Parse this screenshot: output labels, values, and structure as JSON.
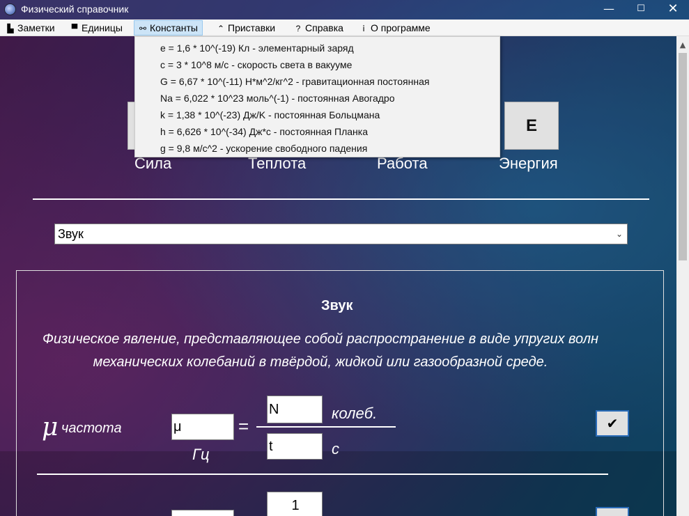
{
  "window": {
    "title": "Физический справочник",
    "minimize": "—",
    "maximize": "☐",
    "close": "✕"
  },
  "menu": [
    {
      "label": "Заметки",
      "icon": "▙",
      "icon_name": "notes-icon"
    },
    {
      "label": "Единицы",
      "icon": "▀",
      "icon_name": "units-icon"
    },
    {
      "label": "Константы",
      "icon": "⚯",
      "icon_name": "constants-icon"
    },
    {
      "label": "Приставки",
      "icon": "⌃",
      "icon_name": "prefixes-icon"
    },
    {
      "label": "Справка",
      "icon": "?",
      "icon_name": "help-icon"
    },
    {
      "label": "О программе",
      "icon": "ⅰ",
      "icon_name": "about-icon"
    }
  ],
  "constants": [
    "e = 1,6 * 10^(-19) Кл - элементарный заряд",
    "c = 3 * 10^8 м/с - скорость света в вакууме",
    "G = 6,67 * 10^(-11) Н*м^2/кг^2 - гравитационная постоянная",
    "Na = 6,022 * 10^23 моль^(-1) - постоянная Авогадро",
    "k = 1,38 * 10^(-23) Дж/K - постоянная Больцмана",
    "h = 6,626 * 10^(-34) Дж*с - постоянная Планка",
    "g = 9,8 м/с^2 - ускорение свободного падения"
  ],
  "tiles": {
    "energy_button": "E"
  },
  "categories": {
    "force": "Сила",
    "heat": "Теплота",
    "work": "Работа",
    "energy": "Энергия"
  },
  "combo": {
    "selected": "Звук",
    "arrow": "⌄"
  },
  "topic": {
    "title": "Звук",
    "description": "Физическое явление, представляющее собой распространение в виде упругих волн механических колебаний в твёрдой, жидкой или газообразной среде."
  },
  "formula1": {
    "symbol": "μ",
    "word": "частота",
    "input_value": "μ",
    "unit": "Гц",
    "equals": "=",
    "numerator": "N",
    "numerator_unit": "колеб.",
    "denominator": "t",
    "denominator_unit": "с",
    "check": "✔"
  },
  "formula2": {
    "numerator": "1"
  },
  "colors": {
    "accent": "#2b6cb8",
    "menu_active": "#cce4f7"
  }
}
